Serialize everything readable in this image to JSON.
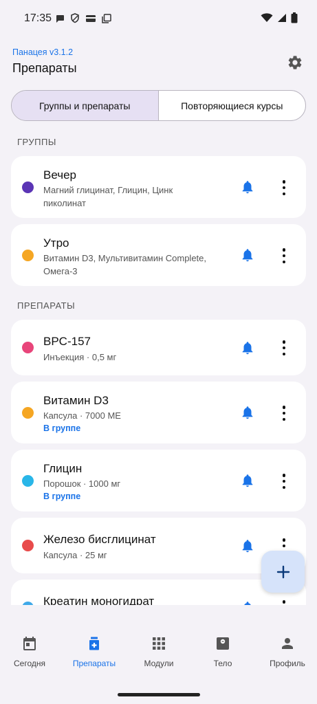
{
  "status_bar": {
    "time": "17:35"
  },
  "header": {
    "app_version": "Панацея v3.1.2",
    "title": "Препараты"
  },
  "segmented": {
    "groups_tab": "Группы и препараты",
    "courses_tab": "Повторяющиеся курсы",
    "active": "groups_tab"
  },
  "sections": {
    "groups": "ГРУППЫ",
    "meds": "ПРЕПАРАТЫ"
  },
  "groups": [
    {
      "name": "Вечер",
      "line1": "Магний глицинат, Глицин, Цинк",
      "line2": "пиколинат",
      "color": "#5B35B5"
    },
    {
      "name": "Утро",
      "line1": "Витамин D3, Мультивитамин Complete,",
      "line2": "Омега-3",
      "color": "#F5A623"
    }
  ],
  "meds": [
    {
      "name": "BPC-157",
      "sub": "Инъекция · 0,5 мг",
      "tag": "",
      "color": "#E8457A"
    },
    {
      "name": "Витамин D3",
      "sub": "Капсула · 7000 МЕ",
      "tag": "В группе",
      "color": "#F5A623"
    },
    {
      "name": "Глицин",
      "sub": "Порошок · 1000 мг",
      "tag": "В группе",
      "color": "#29B6E8"
    },
    {
      "name": "Железо бисглицинат",
      "sub": "Капсула · 25 мг",
      "tag": "",
      "color": "#E84B4B"
    },
    {
      "name": "Креатин моногидрат",
      "sub": "",
      "tag": "",
      "color": "#3FA9E8"
    }
  ],
  "bottom_nav": [
    {
      "label": "Сегодня",
      "icon": "calendar-icon",
      "active": false
    },
    {
      "label": "Препараты",
      "icon": "medicine-icon",
      "active": true
    },
    {
      "label": "Модули",
      "icon": "apps-grid-icon",
      "active": false
    },
    {
      "label": "Тело",
      "icon": "scale-icon",
      "active": false
    },
    {
      "label": "Профиль",
      "icon": "person-icon",
      "active": false
    }
  ],
  "colors": {
    "accent": "#1a73e8",
    "bell": "#1a73e8",
    "fab": "#D6E3FA",
    "active_segment": "#E6E0F3"
  }
}
